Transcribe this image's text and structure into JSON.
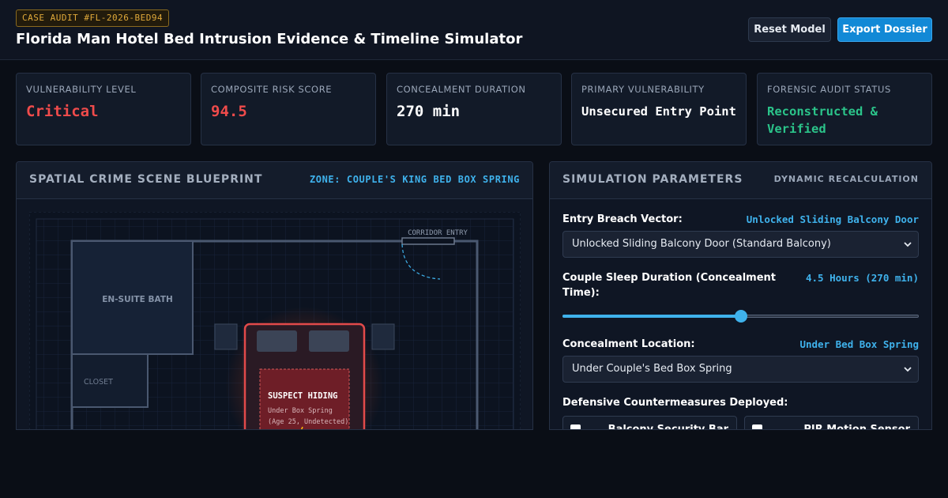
{
  "header": {
    "case_badge": "CASE AUDIT #FL-2026-BED94",
    "title": "Florida Man Hotel Bed Intrusion Evidence & Timeline Simulator",
    "reset_label": "Reset Model",
    "export_label": "Export Dossier"
  },
  "metrics": [
    {
      "label": "VULNERABILITY LEVEL",
      "value": "Critical"
    },
    {
      "label": "COMPOSITE RISK SCORE",
      "value": "94.5"
    },
    {
      "label": "CONCEALMENT DURATION",
      "value": "270 min"
    },
    {
      "label": "PRIMARY VULNERABILITY",
      "value": "Unsecured Entry Point"
    },
    {
      "label": "FORENSIC AUDIT STATUS",
      "value": "Reconstructed & Verified"
    }
  ],
  "blueprint": {
    "title": "SPATIAL CRIME SCENE BLUEPRINT",
    "zone": "ZONE: COUPLE'S KING BED BOX SPRING",
    "rooms": {
      "bath": "EN-SUITE BATH",
      "closet": "CLOSET",
      "corridor": "CORRIDOR ENTRY"
    },
    "suspect": {
      "title": "SUSPECT HIDING",
      "line1": "Under Box Spring",
      "line2": "(Age 25, Undetected)"
    }
  },
  "params": {
    "title": "SIMULATION PARAMETERS",
    "mode": "DYNAMIC RECALCULATION",
    "entry": {
      "label": "Entry Breach Vector:",
      "value": "Unlocked Sliding Balcony Door",
      "selected": "Unlocked Sliding Balcony Door (Standard Balcony)"
    },
    "sleep": {
      "label": "Couple Sleep Duration (Concealment Time):",
      "value": "4.5 Hours (270 min)",
      "slider_fraction": 0.5
    },
    "location": {
      "label": "Concealment Location:",
      "value": "Under Bed Box Spring",
      "selected": "Under Couple's Bed Box Spring"
    },
    "countermeasures": {
      "label": "Defensive Countermeasures Deployed:",
      "items": [
        "Balcony Security Bar",
        "PIR Motion Sensor"
      ]
    }
  },
  "colors": {
    "accent": "#3fb2ec",
    "critical": "#ef4b4b",
    "verified": "#2bc48a",
    "badge": "#e0a93a"
  }
}
